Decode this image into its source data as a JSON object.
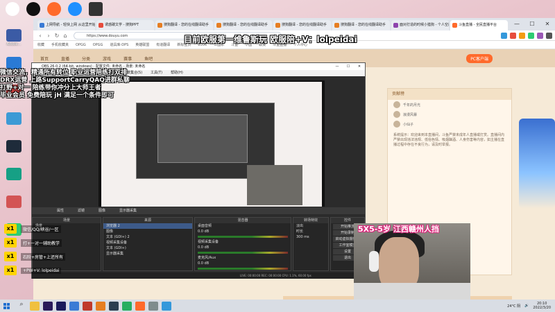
{
  "desktop": {
    "icons": [
      {
        "label": "Adobe…",
        "color": "#3b5ba5"
      },
      {
        "label": "",
        "color": "#2a7ad5"
      },
      {
        "label": "",
        "color": "#c13c3c"
      },
      {
        "label": "",
        "color": "#3c9ad5"
      },
      {
        "label": "",
        "color": "#1e2b3a"
      },
      {
        "label": "",
        "color": "#16a085"
      },
      {
        "label": "",
        "color": "#d35454"
      },
      {
        "label": "",
        "color": "#2ecc71"
      }
    ]
  },
  "browser": {
    "tabs": [
      {
        "label": "上网导航 - 轻快上网 从这里开始",
        "active": false,
        "color": "#3a7bd5"
      },
      {
        "label": "诱惑碳文学 - 搜狗PPT",
        "active": false,
        "color": "#e74c3c"
      },
      {
        "label": "搜狗翻译 - 您的在线翻译助手",
        "active": false,
        "color": "#e67e22"
      },
      {
        "label": "搜狗翻译 - 您的在线翻译助手",
        "active": false,
        "color": "#e67e22"
      },
      {
        "label": "搜狗翻译 - 您的在线翻译助手",
        "active": false,
        "color": "#e67e22"
      },
      {
        "label": "搜狗翻译 - 您的在线翻译助手",
        "active": false,
        "color": "#e67e22"
      },
      {
        "label": "面对打造的时候小猎狗 - 个人空间",
        "active": false,
        "color": "#8e44ad"
      },
      {
        "label": "斗鱼直播 - 全民直播平台",
        "active": true,
        "color": "#ff6a2b"
      }
    ],
    "address": "https://www.douyu.com",
    "bookmarks": [
      "收藏",
      "手机收藏夹",
      "OPGG",
      "OPGG",
      "道具库-DPS",
      "英雄联盟",
      "有道翻译",
      "新标签页",
      "2006",
      "三国杀",
      "斗鱼",
      "中国",
      "联赛",
      "斗鱼直播",
      "个人中心"
    ],
    "colors": {
      "accent": "#ff6a2b"
    }
  },
  "douyu": {
    "nav": [
      "首页",
      "直播",
      "分类",
      "游戏",
      "赛事",
      "鱼吧"
    ],
    "pc_button": "PC客户端",
    "overlay_title": "目前欧服第一维鲁斯玩  欧服陪+V：lolpeidai",
    "chat_header": "贡献榜",
    "fans": [
      "千年的月光",
      "浪漫风暴",
      "小仙子"
    ],
    "chat_text": "系统提示：欢迎来到本直播间，斗鱼严禁未成年人直播或打赏。直播间内严禁出现违法违规、低俗色情、吸烟酗酒、人身伤害等内容，如主播在直播过程中存在不良行为，请及时举报。"
  },
  "obs": {
    "title": "OBS 26.0.2 (64-bit, windows) - 配置文件: 未命名 - 场景: 未命名",
    "window_buttons": [
      "—",
      "☐",
      "✕"
    ],
    "menu": [
      "文件(F)",
      "编辑(E)",
      "视图(V)",
      "配置文件(P)",
      "场景集合(S)",
      "工具(T)",
      "帮助(H)"
    ],
    "toolbar": [
      "属性",
      "滤镜",
      "图像",
      "显示器采集"
    ],
    "docks": [
      {
        "title": "场景",
        "rows": [
          "场景"
        ]
      },
      {
        "title": "来源",
        "rows": [
          "浏览器 2",
          "图像",
          "文本 (GDI+) 2",
          "视频采集设备",
          "文本 (GDI+)",
          "显示器采集"
        ]
      },
      {
        "title": "混音器",
        "rows": [
          "桌面音频",
          "0.0 dB",
          "视频采集设备",
          "0.0 dB",
          "麦克风/Aux",
          "0.0 dB"
        ]
      },
      {
        "title": "转场特效",
        "rows": [
          "淡出",
          "时长",
          "300 ms"
        ]
      },
      {
        "title": "控件",
        "rows": [
          "开始推流",
          "开始录制",
          "启动虚拟摄像机",
          "工作室模式",
          "设置",
          "退出"
        ]
      }
    ],
    "status": "LIVE: 00:00:00   REC: 00:00:00   CPU: 1.1%, 60.00 fps"
  },
  "overlays": {
    "lines": [
      "微信交流，精通所有转位 职业运营陪练打双排",
      "DRX运营 上路SupportCarryQAQ进群私聊",
      "打野+对一 陪练带你冲分上大师王者",
      "毕业会员 免费陪玩 jH 满足一个条件即可"
    ],
    "promo": [
      {
        "badge": "x1",
        "text": "微信/QQ/峡谷/一区"
      },
      {
        "badge": "x1",
        "text": "打+一对一辅助教学"
      },
      {
        "badge": "x1",
        "text": "石阶+房管+上还所有"
      },
      {
        "badge": "x1",
        "text": "+PW+V: lolpeidai"
      }
    ],
    "webcam_caption": "5X5-5岁 江西赣州人挡"
  },
  "taskbar": {
    "apps": [
      {
        "name": "file-explorer",
        "color": "#f0c040"
      },
      {
        "name": "premiere",
        "color": "#2a1a5a"
      },
      {
        "name": "after-effects",
        "color": "#1a1a5a"
      },
      {
        "name": "app-1",
        "color": "#3a7bd5"
      },
      {
        "name": "app-2",
        "color": "#c0392b"
      },
      {
        "name": "app-3",
        "color": "#e67e22"
      },
      {
        "name": "app-4",
        "color": "#2c3e50"
      },
      {
        "name": "app-5",
        "color": "#27ae60"
      },
      {
        "name": "app-6",
        "color": "#ff6a2b"
      },
      {
        "name": "app-7",
        "color": "#7f8c8d"
      },
      {
        "name": "app-8",
        "color": "#3498db"
      }
    ],
    "weather": "24°C 阴",
    "time": "20:10",
    "date": "2022/3/20"
  }
}
